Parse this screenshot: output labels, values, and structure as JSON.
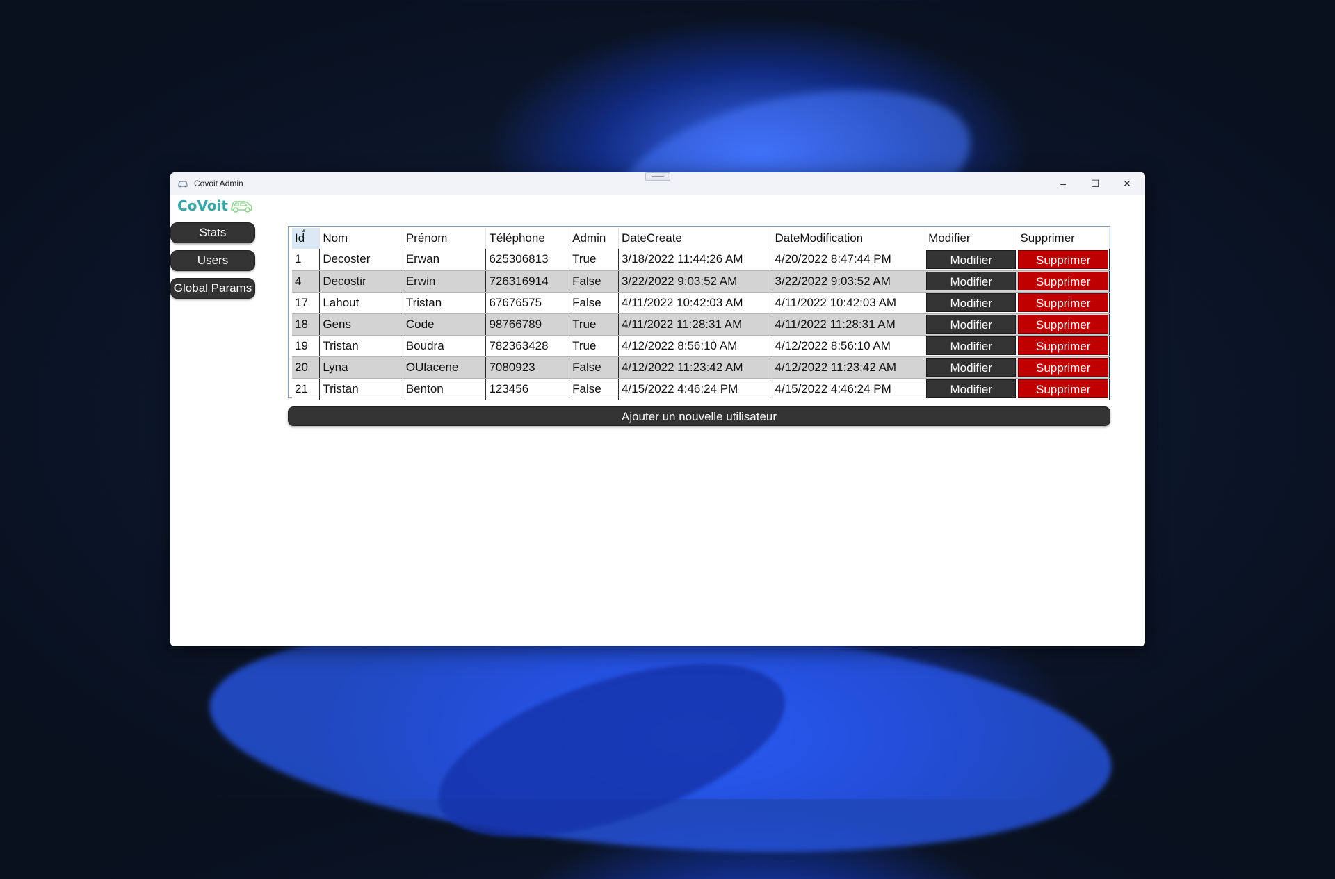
{
  "window": {
    "title": "Covoit Admin",
    "controls": {
      "minimize": "–",
      "maximize": "☐",
      "close": "✕"
    }
  },
  "logo": {
    "text": "CoVoit",
    "icon": "car-icon"
  },
  "sidebar": {
    "items": [
      {
        "label": "Stats"
      },
      {
        "label": "Users"
      },
      {
        "label": "Global Params"
      }
    ]
  },
  "grid": {
    "columns": [
      "Id",
      "Nom",
      "Prénom",
      "Téléphone",
      "Admin",
      "DateCreate",
      "DateModification",
      "Modifier",
      "Supprimer"
    ],
    "rows": [
      {
        "id": "1",
        "nom": "Decoster",
        "prenom": "Erwan",
        "telephone": "625306813",
        "admin": "True",
        "date_create": "3/18/2022 11:44:26 AM",
        "date_modification": "4/20/2022 8:47:44 PM",
        "modifier": "Modifier",
        "supprimer": "Supprimer"
      },
      {
        "id": "4",
        "nom": "Decostir",
        "prenom": "Erwin",
        "telephone": "726316914",
        "admin": "False",
        "date_create": "3/22/2022 9:03:52 AM",
        "date_modification": "3/22/2022 9:03:52 AM",
        "modifier": "Modifier",
        "supprimer": "Supprimer"
      },
      {
        "id": "17",
        "nom": "Lahout",
        "prenom": "Tristan",
        "telephone": "67676575",
        "admin": "False",
        "date_create": "4/11/2022 10:42:03 AM",
        "date_modification": "4/11/2022 10:42:03 AM",
        "modifier": "Modifier",
        "supprimer": "Supprimer"
      },
      {
        "id": "18",
        "nom": "Gens",
        "prenom": "Code",
        "telephone": "98766789",
        "admin": "True",
        "date_create": "4/11/2022 11:28:31 AM",
        "date_modification": "4/11/2022 11:28:31 AM",
        "modifier": "Modifier",
        "supprimer": "Supprimer"
      },
      {
        "id": "19",
        "nom": "Tristan",
        "prenom": "Boudra",
        "telephone": "782363428",
        "admin": "True",
        "date_create": "4/12/2022 8:56:10 AM",
        "date_modification": "4/12/2022 8:56:10 AM",
        "modifier": "Modifier",
        "supprimer": "Supprimer"
      },
      {
        "id": "20",
        "nom": "Lyna",
        "prenom": "OUlacene",
        "telephone": "7080923",
        "admin": "False",
        "date_create": "4/12/2022 11:23:42 AM",
        "date_modification": "4/12/2022 11:23:42 AM",
        "modifier": "Modifier",
        "supprimer": "Supprimer"
      },
      {
        "id": "21",
        "nom": "Tristan",
        "prenom": "Benton",
        "telephone": "123456",
        "admin": "False",
        "date_create": "4/15/2022 4:46:24 PM",
        "date_modification": "4/15/2022 4:46:24 PM",
        "modifier": "Modifier",
        "supprimer": "Supprimer"
      }
    ]
  },
  "add_button": {
    "label": "Ajouter un nouvelle utilisateur"
  },
  "colors": {
    "delete": "#c00000",
    "button_dark": "#333333",
    "alt_row": "#d3d3d3",
    "logo": "#3aa6a6"
  }
}
